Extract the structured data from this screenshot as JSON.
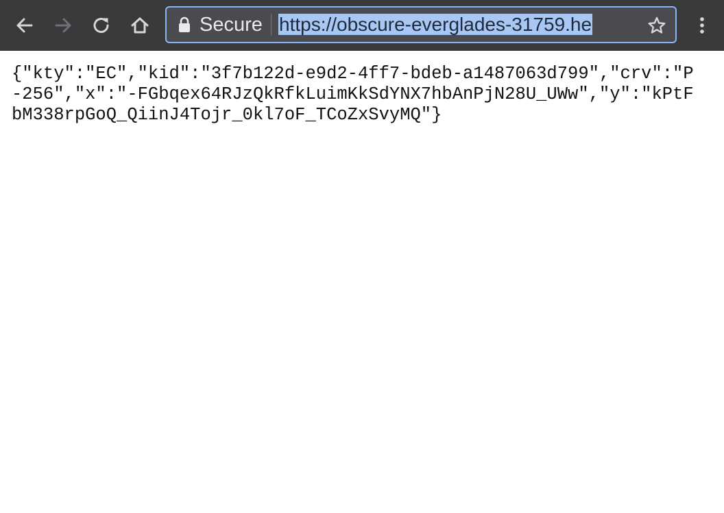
{
  "browser": {
    "toolbar": {
      "back_icon": "arrow-left",
      "forward_icon": "arrow-right",
      "reload_icon": "reload",
      "home_icon": "home",
      "menu_icon": "vertical-dots"
    },
    "omnibox": {
      "security_label": "Secure",
      "url": "https://obscure-everglades-31759.he",
      "bookmark_icon": "star-outline"
    },
    "colors": {
      "toolbar_bg": "#393a3c",
      "omnibox_bg": "#4a4b4e",
      "focus_ring": "#8ab4f8",
      "selection": "#a9c7f5"
    }
  },
  "page": {
    "body_text": "{\"kty\":\"EC\",\"kid\":\"3f7b122d-e9d2-4ff7-bdeb-a1487063d799\",\"crv\":\"P-256\",\"x\":\"-FGbqex64RJzQkRfkLuimKkSdYNX7hbAnPjN28U_UWw\",\"y\":\"kPtFbM338rpGoQ_QiinJ4Tojr_0kl7oF_TCoZxSvyMQ\"}"
  }
}
